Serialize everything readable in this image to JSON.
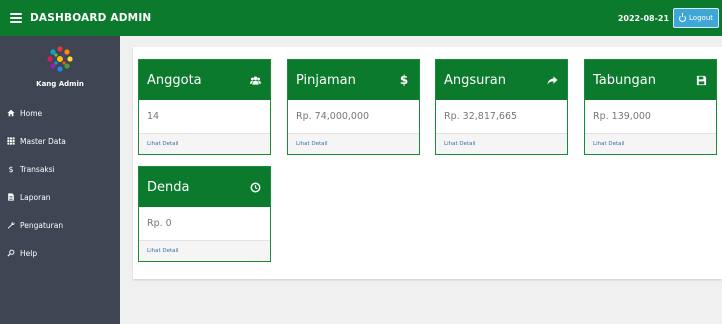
{
  "header": {
    "title": "DASHBOARD ADMIN",
    "date": "2022-08-21",
    "logout_label": "Logout"
  },
  "sidebar": {
    "user_name": "Kang Admin",
    "items": [
      {
        "label": "Home",
        "icon": "home-icon"
      },
      {
        "label": "Master Data",
        "icon": "grid-icon"
      },
      {
        "label": "Transaksi",
        "icon": "dollar-icon"
      },
      {
        "label": "Laporan",
        "icon": "file-icon"
      },
      {
        "label": "Pengaturan",
        "icon": "wrench-icon"
      },
      {
        "label": "Help",
        "icon": "search-icon"
      }
    ]
  },
  "cards": [
    {
      "title": "Anggota",
      "value": "14",
      "link": "Lihat Detail",
      "icon": "users-icon"
    },
    {
      "title": "Pinjaman",
      "value": "Rp. 74,000,000",
      "link": "Lihat Detail",
      "icon": "dollar-icon"
    },
    {
      "title": "Angsuran",
      "value": "Rp. 32,817,665",
      "link": "Lihat Detail",
      "icon": "share-arrow-icon"
    },
    {
      "title": "Tabungan",
      "value": "Rp. 139,000",
      "link": "Lihat Detail",
      "icon": "save-icon"
    },
    {
      "title": "Denda",
      "value": "Rp. 0",
      "link": "Lihat Detail",
      "icon": "clock-icon"
    }
  ],
  "colors": {
    "primary_green": "#0b7a2c",
    "sidebar_bg": "#3f4552",
    "logout_blue": "#3fa7d6"
  }
}
